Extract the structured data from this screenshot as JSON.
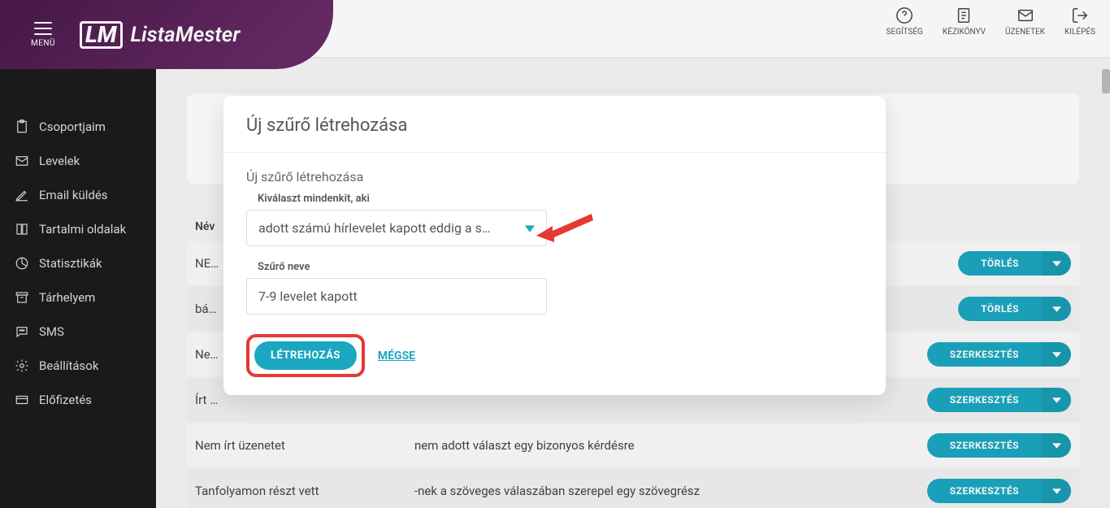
{
  "header": {
    "menu_label": "MENÜ",
    "brand_logo": "LM",
    "brand_text": "ListaMester",
    "actions": {
      "help": "SEGÍTSÉG",
      "handbook": "KÉZIKÖNYV",
      "messages": "ÜZENETEK",
      "logout": "KILÉPÉS"
    }
  },
  "sidebar": {
    "items": {
      "groups": "Csoportjaim",
      "letters": "Levelek",
      "email_send": "Email küldés",
      "content_pages": "Tartalmi oldalak",
      "statistics": "Statisztikák",
      "storage": "Tárhelyem",
      "sms": "SMS",
      "settings": "Beállítások",
      "subscription": "Előfizetés"
    }
  },
  "table": {
    "header_name": "Név",
    "rows": [
      {
        "name": "NE…",
        "desc": "",
        "action": "TÖRLÉS"
      },
      {
        "name": "bá…",
        "desc": "",
        "action": "TÖRLÉS"
      },
      {
        "name": "Ne…",
        "desc": "",
        "action": "SZERKESZTÉS"
      },
      {
        "name": "Írt …",
        "desc": "",
        "action": "SZERKESZTÉS"
      },
      {
        "name": "Nem írt üzenetet",
        "desc": "nem adott választ egy bizonyos kérdésre",
        "action": "SZERKESZTÉS"
      },
      {
        "name": "Tanfolyamon részt vett",
        "desc": "-nek a szöveges válaszában szerepel egy szövegrész",
        "action": "SZERKESZTÉS"
      }
    ]
  },
  "modal": {
    "title": "Új szűrő létrehozása",
    "subtitle": "Új szűrő létrehozása",
    "select_label": "Kiválaszt mindenkit, aki",
    "select_value": "adott számú hírlevelet kapott eddig a s…",
    "name_label": "Szűrő neve",
    "name_value": "7-9 levelet kapott",
    "create_btn": "LÉTREHOZÁS",
    "cancel_btn": "MÉGSE"
  }
}
